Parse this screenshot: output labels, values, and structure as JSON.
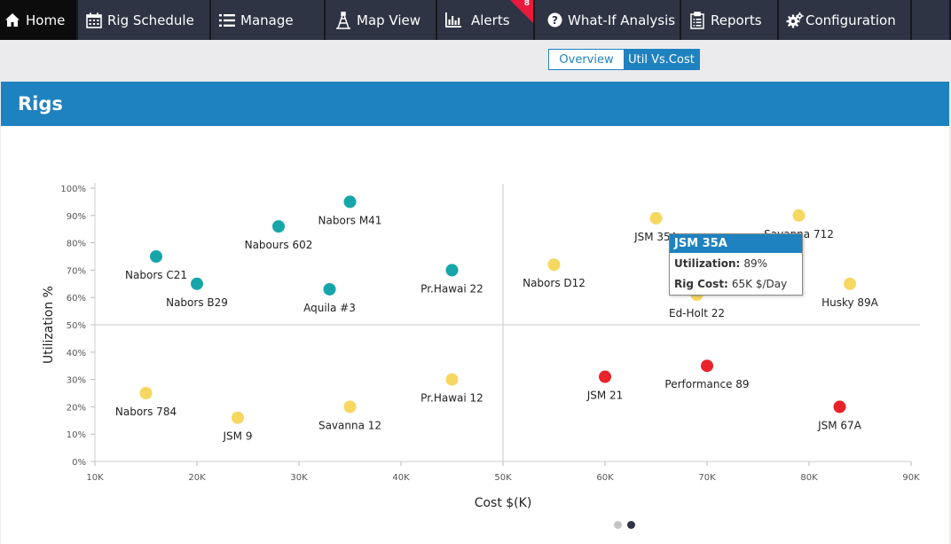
{
  "nav": {
    "items": [
      {
        "label": "Home",
        "icon": "home-icon",
        "name": "nav-home",
        "active": true
      },
      {
        "label": "Rig Schedule",
        "icon": "calendar-icon",
        "name": "nav-rig-schedule"
      },
      {
        "label": "Manage",
        "icon": "list-icon",
        "name": "nav-manage"
      },
      {
        "label": "Map View",
        "icon": "oil-rig-icon",
        "name": "nav-map-view"
      },
      {
        "label": "Alerts",
        "icon": "bar-chart-icon",
        "name": "nav-alerts",
        "badge": "8"
      },
      {
        "label": "What-If Analysis",
        "icon": "question-icon",
        "name": "nav-what-if-analysis"
      },
      {
        "label": "Reports",
        "icon": "clipboard-icon",
        "name": "nav-reports"
      },
      {
        "label": "Configuration",
        "icon": "gears-icon",
        "name": "nav-configuration"
      }
    ]
  },
  "panel": {
    "title": "Rigs"
  },
  "toggle": {
    "overview": "Overview",
    "util_vs_cost": "Util Vs.Cost",
    "selected": "Util Vs.Cost"
  },
  "colors": {
    "header": "#1f82c0",
    "teal": "#16a6aa",
    "yellow": "#f6d860",
    "red": "#e8232c",
    "nav_bg": "#2e3443"
  },
  "tooltip": {
    "title": "JSM 35A",
    "utilization_label": "Utilization:",
    "utilization_value": "89%",
    "cost_label": "Rig Cost:",
    "cost_value": "65K $/Day"
  },
  "carousel": {
    "count": 2,
    "active": 1
  },
  "chart_data": {
    "type": "scatter",
    "xlabel": "Cost $(K)",
    "ylabel": "Utilization %",
    "xlim": [
      10,
      90
    ],
    "ylim": [
      0,
      100
    ],
    "x_ticks": [
      "10K",
      "20K",
      "30K",
      "40K",
      "50K",
      "60K",
      "70K",
      "80K",
      "90K"
    ],
    "y_ticks": [
      "0%",
      "10%",
      "20%",
      "30%",
      "40%",
      "50%",
      "60%",
      "70%",
      "80%",
      "90%",
      "100%"
    ],
    "quadrant_lines": {
      "x": 50,
      "y": 50
    },
    "points": [
      {
        "label": "Nabors M41",
        "x": 35,
        "y": 95,
        "color": "teal"
      },
      {
        "label": "Nabours 602",
        "x": 28,
        "y": 86,
        "color": "teal"
      },
      {
        "label": "Nabors C21",
        "x": 16,
        "y": 75,
        "color": "teal"
      },
      {
        "label": "Nabors B29",
        "x": 20,
        "y": 65,
        "color": "teal"
      },
      {
        "label": "Aquila #3",
        "x": 33,
        "y": 63,
        "color": "teal"
      },
      {
        "label": "Pr.Hawai 22",
        "x": 45,
        "y": 70,
        "color": "teal"
      },
      {
        "label": "Nabors D12",
        "x": 55,
        "y": 72,
        "color": "yellow"
      },
      {
        "label": "JSM 35A",
        "x": 65,
        "y": 89,
        "color": "yellow"
      },
      {
        "label": "Savanna 712",
        "x": 79,
        "y": 90,
        "color": "yellow"
      },
      {
        "label": "Ed-Holt 22",
        "x": 69,
        "y": 61,
        "color": "yellow"
      },
      {
        "label": "Husky 89A",
        "x": 84,
        "y": 65,
        "color": "yellow"
      },
      {
        "label": "Nabors 784",
        "x": 15,
        "y": 25,
        "color": "yellow"
      },
      {
        "label": "JSM 9",
        "x": 24,
        "y": 16,
        "color": "yellow"
      },
      {
        "label": "Savanna 12",
        "x": 35,
        "y": 20,
        "color": "yellow"
      },
      {
        "label": "Pr.Hawai 12",
        "x": 45,
        "y": 30,
        "color": "yellow"
      },
      {
        "label": "JSM 21",
        "x": 60,
        "y": 31,
        "color": "red"
      },
      {
        "label": "Performance 89",
        "x": 70,
        "y": 35,
        "color": "red"
      },
      {
        "label": "JSM 67A",
        "x": 83,
        "y": 20,
        "color": "red"
      }
    ]
  }
}
